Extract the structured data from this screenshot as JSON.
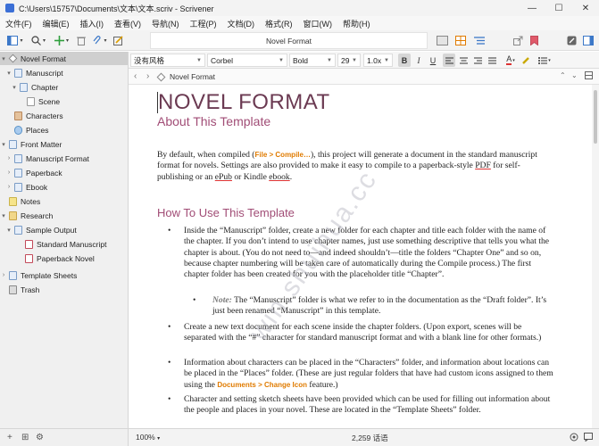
{
  "window": {
    "title": "C:\\Users\\15757\\Documents\\文本\\文本.scriv - Scrivener",
    "minimize": "—",
    "maximize": "☐",
    "close": "✕"
  },
  "menu": [
    "文件(F)",
    "编辑(E)",
    "插入(I)",
    "查看(V)",
    "导航(N)",
    "工程(P)",
    "文档(D)",
    "格式(R)",
    "窗口(W)",
    "帮助(H)"
  ],
  "toolbar": {
    "document_title": "Novel Format"
  },
  "format_bar": {
    "style": "没有风格",
    "font": "Corbel",
    "weight": "Bold",
    "size": "29",
    "line_spacing": "1.0x",
    "bold": "B",
    "italic": "I",
    "underline": "U"
  },
  "binder": {
    "items": [
      {
        "label": "Novel Format",
        "selected": true
      },
      {
        "label": "Manuscript"
      },
      {
        "label": "Chapter"
      },
      {
        "label": "Scene"
      },
      {
        "label": "Characters"
      },
      {
        "label": "Places"
      },
      {
        "label": "Front Matter"
      },
      {
        "label": "Manuscript Format"
      },
      {
        "label": "Paperback"
      },
      {
        "label": "Ebook"
      },
      {
        "label": "Notes"
      },
      {
        "label": "Research"
      },
      {
        "label": "Sample Output"
      },
      {
        "label": "Standard Manuscript"
      },
      {
        "label": "Paperback Novel"
      },
      {
        "label": "Template Sheets"
      },
      {
        "label": "Trash"
      }
    ]
  },
  "header": {
    "title": "Novel Format"
  },
  "document": {
    "title": "NOVEL FORMAT",
    "subtitle": "About This Template",
    "intro_a": "By default, when compiled (",
    "intro_hl": "File > Compile…",
    "intro_b": "), this project will generate a document in the standard manuscript format for novels. Settings are also provided to make it easy to compile to a paperback-style ",
    "intro_pdf": "PDF",
    "intro_c": " for self-publishing or an ",
    "intro_epub": "ePub",
    "intro_d": " or Kindle ",
    "intro_ebook": "ebook",
    "intro_e": ".",
    "section_heading": "How To Use This Template",
    "bullet1": "Inside the “Manuscript” folder, create a new folder for each chapter and title each folder with the name of the chapter. If you don’t intend to use chapter names, just use something descriptive that tells you what the chapter is about. (You do not need to—and indeed shouldn’t—title the folders “Chapter One” and so on, because chapter numbering will be taken care of automatically during the Compile process.) The first chapter folder has been created for you with the placeholder title “Chapter”.",
    "note_label": "Note:",
    "note_text": " The “Manuscript” folder is what we refer to in the documentation as the “Draft folder”. It’s just been renamed “Manuscript” in this template.",
    "bullet2": "Create a new text document for each scene inside the chapter folders. (Upon export, scenes will be separated with the “#” character for standard manuscript format and with a blank line for other formats.)",
    "bullet3_a": "Information about characters can be placed in the “Characters” folder, and information about locations can be placed in the “Places” folder. (These are just regular folders that have had custom icons assigned to them using the ",
    "bullet3_hl": "Documents > Change Icon",
    "bullet3_b": " feature.)",
    "bullet4": "Character and setting sketch sheets have been provided which can be used for filling out information about the people and places in your novel. These are located in the “Template Sheets” folder."
  },
  "watermark": "win.shuihua.cc",
  "footer": {
    "zoom": "100%",
    "word_count": "2,259 话语"
  }
}
